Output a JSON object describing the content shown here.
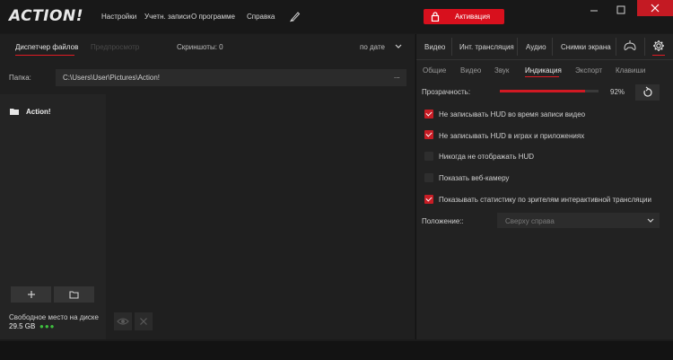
{
  "app": {
    "logo": "ACTION!",
    "menu": [
      "Настройки",
      "Учетн. записи",
      "О программе",
      "Справка"
    ],
    "activation_label": "Активация",
    "colors": {
      "accent": "#d8101d",
      "bg": "#1b1b1b"
    }
  },
  "left": {
    "tabs": [
      "Диспетчер файлов",
      "Предпросмотр"
    ],
    "screenshots": "Скриншоты: 0",
    "sort": "по дате",
    "folder_label": "Папка:",
    "folder_path": "C:\\Users\\User\\Pictures\\Action!",
    "folder_more": "...",
    "tree_item": "Action!",
    "free_space_label": "Свободное место на диске",
    "free_space_value": "29.5 GB"
  },
  "right": {
    "tabs": [
      "Видео",
      "Инт. трансляция",
      "Аудио",
      "Снимки экрана"
    ],
    "subtabs": [
      "Общие",
      "Видео",
      "Звук",
      "Индикация",
      "Экспорт",
      "Клавиши"
    ],
    "active_subtab": "Индикация",
    "transparency_label": "Прозрачность:",
    "transparency_value": "92%",
    "transparency_fraction": 0.92,
    "options": [
      {
        "label": "Не записывать HUD во время записи видео",
        "checked": true
      },
      {
        "label": "Не записывать HUD в играх и приложениях",
        "checked": true
      },
      {
        "label": "Никогда не отображать HUD",
        "checked": false
      },
      {
        "label": "Показать веб-камеру",
        "checked": false
      },
      {
        "label": "Показывать статистику по зрителям интерактивной трансляции",
        "checked": true
      }
    ],
    "position_label": "Положение::",
    "position_value": "Сверху справа"
  }
}
